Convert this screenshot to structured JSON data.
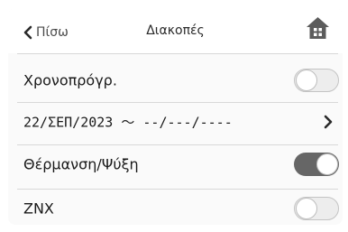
{
  "header": {
    "back_label": "Πίσω",
    "title": "Διακοπές",
    "home_icon": "home-icon"
  },
  "rows": [
    {
      "label": "Χρονοπρόγρ.",
      "control": "toggle",
      "state": "off"
    },
    {
      "label": "22/ΣΕΠ/2023  ～  --/---/----",
      "control": "chevron",
      "icon": "chevron-right-icon"
    },
    {
      "label": "Θέρμανση/Ψύξη",
      "control": "toggle",
      "state": "on"
    },
    {
      "label": "ZNX",
      "control": "toggle",
      "state": "off"
    }
  ],
  "colors": {
    "toggle_on": "#666666",
    "toggle_off": "#ededed",
    "divider": "#d8d8d8"
  }
}
